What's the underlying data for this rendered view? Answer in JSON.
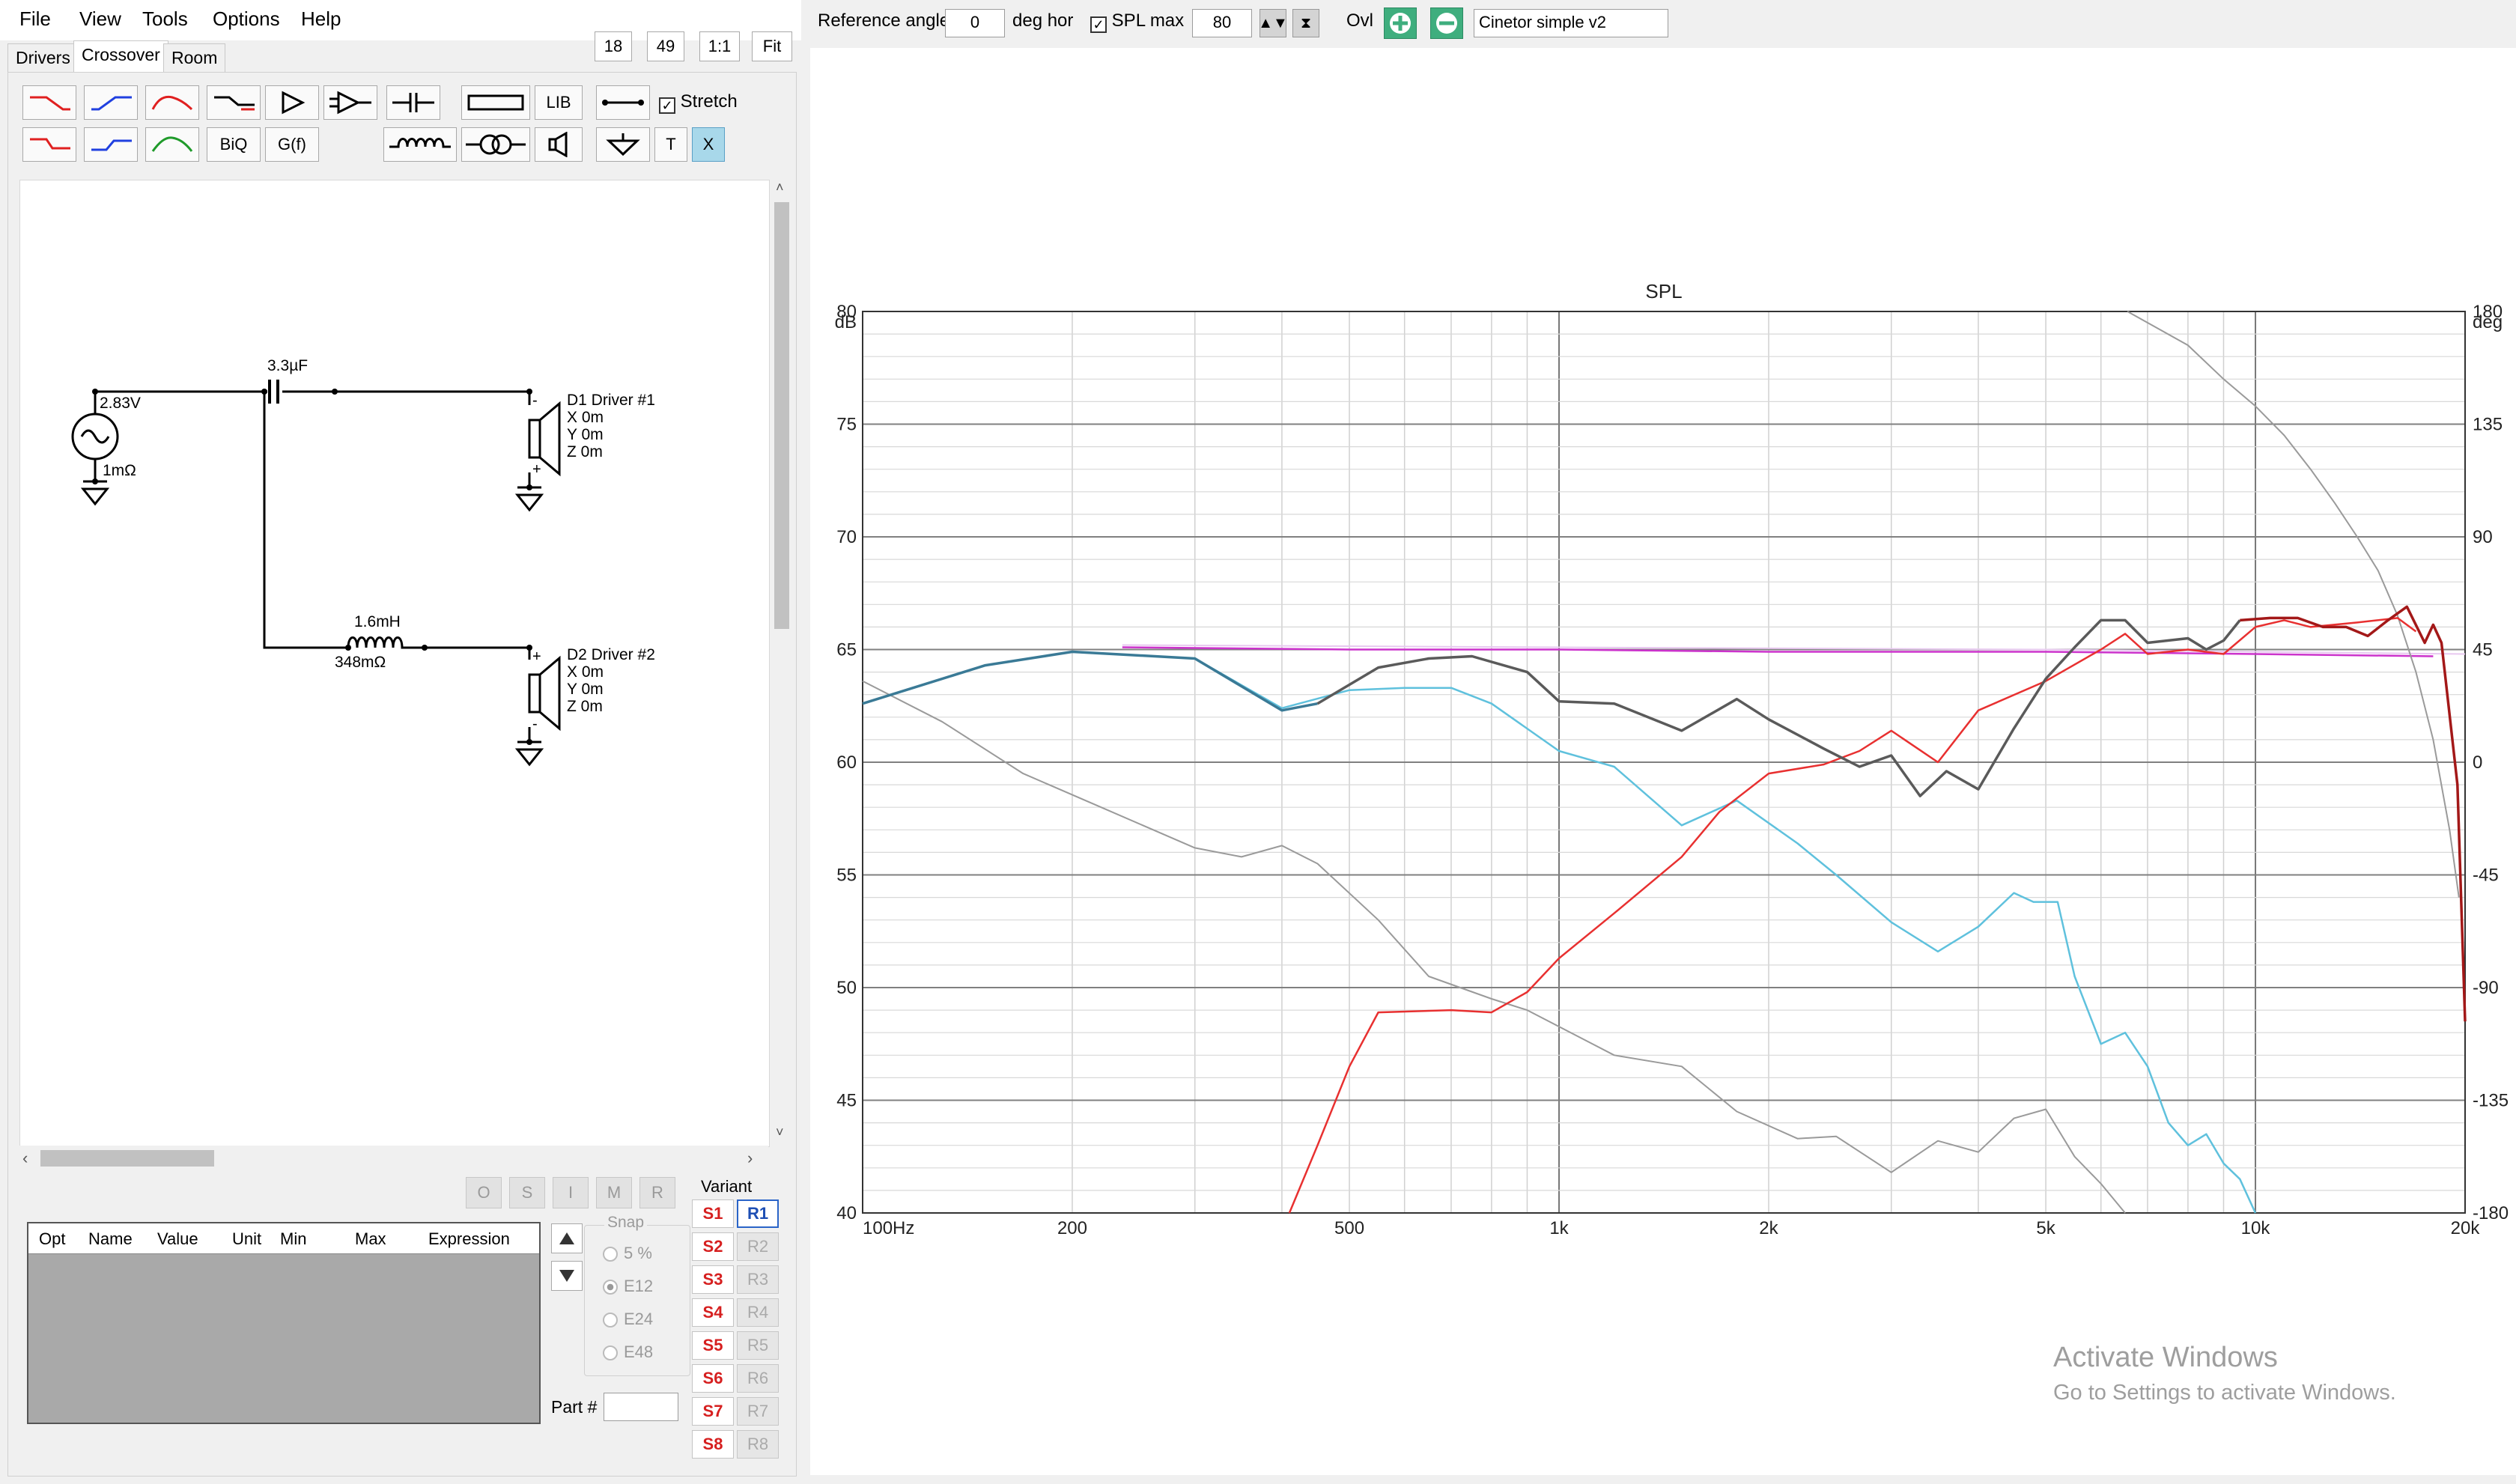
{
  "menu": {
    "file": "File",
    "view": "View",
    "tools": "Tools",
    "options": "Options",
    "help": "Help"
  },
  "tabs": {
    "drivers": "Drivers",
    "crossover": "Crossover",
    "room": "Room"
  },
  "zoom_buttons": {
    "b18": "18",
    "b49": "49",
    "one": "1:1",
    "fit": "Fit"
  },
  "toolbar": {
    "lib": "LIB",
    "biq": "BiQ",
    "gf": "G(f)",
    "t": "T",
    "x": "X",
    "stretch": "Stretch",
    "stretch_checked": true
  },
  "schematic": {
    "source_voltage": "2.83V",
    "source_resistance": "1mΩ",
    "cap_value": "3.3µF",
    "inductor_value": "1.6mH",
    "inductor_resistance": "348mΩ",
    "driver1": {
      "name": "D1 Driver #1",
      "x": "X 0m",
      "y": "Y 0m",
      "z": "Z 0m"
    },
    "driver2": {
      "name": "D2 Driver #2",
      "x": "X 0m",
      "y": "Y 0m",
      "z": "Z 0m"
    }
  },
  "opt_buttons": [
    "O",
    "S",
    "I",
    "M",
    "R"
  ],
  "param_table": {
    "columns": [
      "Opt",
      "Name",
      "Value",
      "Unit",
      "Min",
      "Max",
      "Expression"
    ]
  },
  "snap": {
    "label": "Snap",
    "options": [
      "5 %",
      "E12",
      "E24",
      "E48"
    ],
    "selected": "E12"
  },
  "part_label": "Part #",
  "part_value": "",
  "variant": {
    "label": "Variant",
    "s": [
      "S1",
      "S2",
      "S3",
      "S4",
      "S5",
      "S6",
      "S7",
      "S8"
    ],
    "r": [
      "R1",
      "R2",
      "R3",
      "R4",
      "R5",
      "R6",
      "R7",
      "R8"
    ],
    "selected": "R1"
  },
  "top_controls": {
    "reference_angle_label": "Reference angle",
    "reference_angle_value": "0",
    "deg_hor": "deg hor",
    "spl_max_label": "SPL max",
    "spl_max_checked": true,
    "spl_max_value": "80",
    "ovl": "Ovl",
    "project_name": "Cinetor simple v2"
  },
  "watermark": {
    "title": "Activate Windows",
    "subtitle": "Go to Settings to activate Windows."
  },
  "chart_data": {
    "type": "line",
    "title": "SPL",
    "x_scale": "log",
    "xlim": [
      100,
      20000
    ],
    "ylim": [
      40,
      80
    ],
    "ylim_right": [
      -180,
      180
    ],
    "ylabel": "dB",
    "ylabel_right": "deg",
    "x_ticks": [
      {
        "v": 100,
        "t": "100Hz"
      },
      {
        "v": 200,
        "t": "200"
      },
      {
        "v": 500,
        "t": "500"
      },
      {
        "v": 1000,
        "t": "1k"
      },
      {
        "v": 2000,
        "t": "2k"
      },
      {
        "v": 5000,
        "t": "5k"
      },
      {
        "v": 10000,
        "t": "10k"
      },
      {
        "v": 20000,
        "t": "20k"
      }
    ],
    "y_ticks": [
      40,
      45,
      50,
      55,
      60,
      65,
      70,
      75,
      80
    ],
    "y_ticks_right": [
      -180,
      -135,
      -90,
      -45,
      0,
      45,
      90,
      135,
      180
    ],
    "grid": true,
    "series": [
      {
        "color": "#e8c8f0",
        "width": 2,
        "points": [
          [
            236,
            65.2
          ],
          [
            1000,
            65.1
          ],
          [
            5000,
            65.0
          ],
          [
            20000,
            64.8
          ]
        ]
      },
      {
        "color": "#cc33cc",
        "width": 2.5,
        "points": [
          [
            236,
            65.1
          ],
          [
            500,
            65.0
          ],
          [
            1000,
            65.0
          ],
          [
            2000,
            64.9
          ],
          [
            5000,
            64.9
          ],
          [
            10000,
            64.8
          ],
          [
            18000,
            64.7
          ]
        ]
      },
      {
        "color": "#9a9a9a",
        "width": 2,
        "points": [
          [
            100,
            63.6
          ],
          [
            130,
            61.8
          ],
          [
            170,
            59.5
          ],
          [
            220,
            58.0
          ],
          [
            300,
            56.2
          ],
          [
            350,
            55.8
          ],
          [
            400,
            56.3
          ],
          [
            450,
            55.5
          ],
          [
            550,
            53.0
          ],
          [
            650,
            50.5
          ],
          [
            800,
            49.5
          ],
          [
            900,
            49.0
          ],
          [
            1200,
            47.0
          ],
          [
            1500,
            46.5
          ],
          [
            1800,
            44.5
          ],
          [
            2200,
            43.3
          ],
          [
            2500,
            43.4
          ],
          [
            3000,
            41.8
          ],
          [
            3500,
            43.2
          ],
          [
            4000,
            42.7
          ],
          [
            4500,
            44.2
          ],
          [
            5000,
            44.6
          ],
          [
            5500,
            42.5
          ],
          [
            6000,
            41.3
          ],
          [
            6500,
            40.0
          ]
        ]
      },
      {
        "color": "#9a9a9a",
        "width": 2,
        "points": [
          [
            6550,
            80.0
          ],
          [
            7000,
            79.5
          ],
          [
            8000,
            78.5
          ],
          [
            9000,
            77.0
          ],
          [
            10000,
            75.8
          ],
          [
            11000,
            74.5
          ],
          [
            12000,
            73.0
          ],
          [
            13000,
            71.5
          ],
          [
            14000,
            70.0
          ],
          [
            15000,
            68.5
          ],
          [
            16000,
            66.5
          ],
          [
            17000,
            64.0
          ],
          [
            18000,
            61.0
          ],
          [
            19000,
            57.0
          ],
          [
            19600,
            54.0
          ]
        ]
      },
      {
        "color": "#5fc1dd",
        "width": 2.5,
        "points": [
          [
            100,
            62.6
          ],
          [
            150,
            64.3
          ],
          [
            200,
            64.9
          ],
          [
            300,
            64.6
          ],
          [
            400,
            62.4
          ],
          [
            500,
            63.2
          ],
          [
            600,
            63.3
          ],
          [
            700,
            63.3
          ],
          [
            800,
            62.6
          ],
          [
            1000,
            60.5
          ],
          [
            1200,
            59.8
          ],
          [
            1500,
            57.2
          ],
          [
            1800,
            58.3
          ],
          [
            2200,
            56.4
          ],
          [
            2500,
            55.0
          ],
          [
            3000,
            52.9
          ],
          [
            3500,
            51.6
          ],
          [
            4000,
            52.7
          ],
          [
            4500,
            54.2
          ],
          [
            4800,
            53.8
          ],
          [
            5200,
            53.8
          ],
          [
            5500,
            50.5
          ],
          [
            6000,
            47.5
          ],
          [
            6500,
            48.0
          ],
          [
            7000,
            46.5
          ],
          [
            7500,
            44.0
          ],
          [
            8000,
            43.0
          ],
          [
            8500,
            43.5
          ],
          [
            9000,
            42.2
          ],
          [
            9500,
            41.5
          ],
          [
            10000,
            40.0
          ]
        ]
      },
      {
        "color": "#e83030",
        "width": 2.5,
        "points": [
          [
            410,
            40.0
          ],
          [
            450,
            43.0
          ],
          [
            500,
            46.5
          ],
          [
            550,
            48.9
          ],
          [
            700,
            49.0
          ],
          [
            800,
            48.9
          ],
          [
            900,
            49.8
          ],
          [
            1000,
            51.3
          ],
          [
            1200,
            53.3
          ],
          [
            1500,
            55.8
          ],
          [
            1700,
            57.8
          ],
          [
            2000,
            59.5
          ],
          [
            2400,
            59.9
          ],
          [
            2700,
            60.5
          ],
          [
            3000,
            61.4
          ],
          [
            3500,
            60.0
          ],
          [
            4000,
            62.3
          ],
          [
            5000,
            63.6
          ],
          [
            6000,
            65.0
          ],
          [
            6500,
            65.7
          ],
          [
            7000,
            64.8
          ],
          [
            8000,
            65.0
          ],
          [
            9000,
            64.8
          ],
          [
            10000,
            66.0
          ],
          [
            11000,
            66.3
          ],
          [
            12000,
            66.0
          ],
          [
            14000,
            66.2
          ],
          [
            16000,
            66.4
          ],
          [
            17000,
            65.8
          ]
        ]
      },
      {
        "color": "#3a7a96",
        "width": 3.5,
        "points": [
          [
            100,
            62.6
          ],
          [
            150,
            64.3
          ],
          [
            200,
            64.9
          ],
          [
            300,
            64.6
          ],
          [
            400,
            62.3
          ],
          [
            450,
            62.6
          ]
        ]
      },
      {
        "color": "#5a5a5a",
        "width": 3.5,
        "points": [
          [
            450,
            62.6
          ],
          [
            550,
            64.2
          ],
          [
            650,
            64.6
          ],
          [
            750,
            64.7
          ],
          [
            900,
            64.0
          ],
          [
            1000,
            62.7
          ],
          [
            1200,
            62.6
          ],
          [
            1500,
            61.4
          ],
          [
            1800,
            62.8
          ],
          [
            2000,
            61.9
          ],
          [
            2400,
            60.6
          ],
          [
            2700,
            59.8
          ],
          [
            3000,
            60.3
          ],
          [
            3300,
            58.5
          ],
          [
            3600,
            59.6
          ],
          [
            4000,
            58.8
          ],
          [
            4500,
            61.5
          ],
          [
            5000,
            63.7
          ],
          [
            5500,
            65.1
          ],
          [
            6000,
            66.3
          ],
          [
            6500,
            66.3
          ],
          [
            7000,
            65.3
          ],
          [
            8000,
            65.5
          ],
          [
            8500,
            65.0
          ],
          [
            9000,
            65.4
          ],
          [
            9500,
            66.3
          ]
        ]
      },
      {
        "color": "#a31818",
        "width": 3.5,
        "points": [
          [
            9500,
            66.3
          ],
          [
            10500,
            66.4
          ],
          [
            11500,
            66.4
          ],
          [
            12500,
            66.0
          ],
          [
            13500,
            66.0
          ],
          [
            14500,
            65.6
          ],
          [
            15500,
            66.3
          ],
          [
            16500,
            66.9
          ],
          [
            17500,
            65.3
          ],
          [
            18000,
            66.1
          ],
          [
            18500,
            65.3
          ],
          [
            19500,
            59.0
          ],
          [
            20000,
            48.5
          ]
        ]
      }
    ]
  }
}
